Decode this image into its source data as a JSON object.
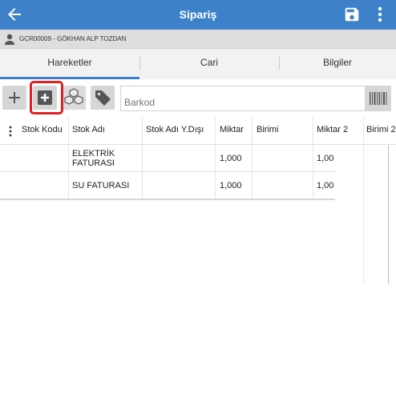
{
  "header": {
    "title": "Sipariş"
  },
  "user": {
    "label": "GCR00009 - GÖKHAN ALP TOZDAN"
  },
  "tabs": [
    {
      "label": "Hareketler",
      "active": true
    },
    {
      "label": "Cari",
      "active": false
    },
    {
      "label": "Bilgiler",
      "active": false
    }
  ],
  "toolbar": {
    "barcode_placeholder": "Barkod",
    "highlight_color": "#e02020"
  },
  "table": {
    "columns": [
      "Stok Kodu",
      "Stok Adı",
      "Stok Adı Y.Dışı",
      "Miktar",
      "Birimi",
      "Miktar 2",
      "Birimi 2"
    ],
    "rows": [
      {
        "stok_kodu": "",
        "stok_adi_1": "ELEKTRİK",
        "stok_adi_2": "FATURASI",
        "stok_adi_ydisi": "",
        "miktar": "1,000",
        "birimi": "",
        "miktar2": "1,00"
      },
      {
        "stok_kodu": "",
        "stok_adi_1": "SU FATURASI",
        "stok_adi_2": "",
        "stok_adi_ydisi": "",
        "miktar": "1,000",
        "birimi": "",
        "miktar2": "1,00"
      }
    ]
  },
  "colors": {
    "primary": "#3d82c8",
    "user_bar": "#dedede",
    "tab_bar": "#f2f2f2"
  }
}
